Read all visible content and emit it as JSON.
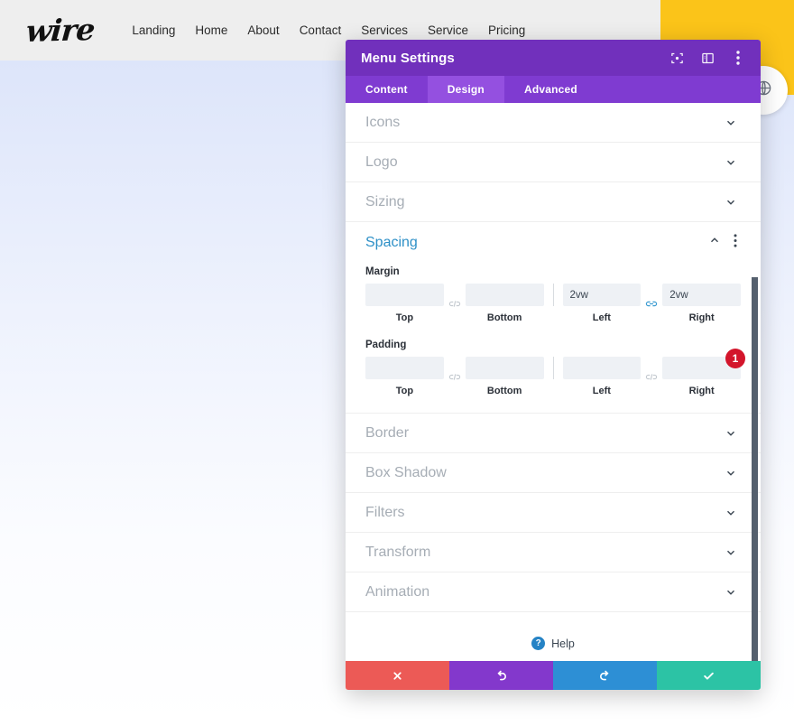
{
  "site": {
    "logo_text": "wire",
    "nav_links": [
      {
        "label": "Landing"
      },
      {
        "label": "Home"
      },
      {
        "label": "About"
      },
      {
        "label": "Contact"
      },
      {
        "label": "Services"
      },
      {
        "label": "Service"
      },
      {
        "label": "Pricing"
      }
    ],
    "round_button_icon": "globe-icon",
    "accent_yellow": "#fbc419"
  },
  "modal": {
    "title": "Menu Settings",
    "header_icons": [
      {
        "name": "focus-icon"
      },
      {
        "name": "layout-panel-icon"
      },
      {
        "name": "more-vertical-icon"
      }
    ],
    "tabs": [
      {
        "label": "Content",
        "active": false
      },
      {
        "label": "Design",
        "active": true
      },
      {
        "label": "Advanced",
        "active": false
      }
    ],
    "sections": [
      {
        "label": "Icons",
        "open": false
      },
      {
        "label": "Logo",
        "open": false
      },
      {
        "label": "Sizing",
        "open": false
      }
    ],
    "spacing": {
      "label": "Spacing",
      "open": true,
      "collapse_icon": "chevron-up-icon",
      "options_icon": "more-vertical-icon",
      "margin": {
        "label": "Margin",
        "top": {
          "label": "Top",
          "value": "",
          "placeholder": ""
        },
        "bottom": {
          "label": "Bottom",
          "value": "",
          "placeholder": ""
        },
        "left": {
          "label": "Left",
          "value": "2vw",
          "placeholder": ""
        },
        "right": {
          "label": "Right",
          "value": "2vw",
          "placeholder": ""
        },
        "link_vertical": "unlinked",
        "link_horizontal": "linked"
      },
      "padding": {
        "label": "Padding",
        "top": {
          "label": "Top",
          "value": "",
          "placeholder": ""
        },
        "bottom": {
          "label": "Bottom",
          "value": "",
          "placeholder": ""
        },
        "left": {
          "label": "Left",
          "value": "",
          "placeholder": ""
        },
        "right": {
          "label": "Right",
          "value": "",
          "placeholder": ""
        },
        "link_vertical": "unlinked",
        "link_horizontal": "unlinked"
      },
      "badge": "1"
    },
    "sections_after": [
      {
        "label": "Border",
        "open": false
      },
      {
        "label": "Box Shadow",
        "open": false
      },
      {
        "label": "Filters",
        "open": false
      },
      {
        "label": "Transform",
        "open": false
      },
      {
        "label": "Animation",
        "open": false
      }
    ],
    "help": {
      "label": "Help",
      "icon": "question-circle-icon"
    },
    "footer_buttons": [
      {
        "name": "cancel-button",
        "icon": "close-icon",
        "color": "#ec5a56"
      },
      {
        "name": "undo-button",
        "icon": "undo-icon",
        "color": "#8338cc"
      },
      {
        "name": "redo-button",
        "icon": "redo-icon",
        "color": "#2d8fd5"
      },
      {
        "name": "save-button",
        "icon": "check-icon",
        "color": "#2cc3a5"
      }
    ],
    "colors": {
      "header_purple": "#7130bc",
      "tabbar_purple": "#7f3bd1",
      "tab_active_purple": "#9450e0",
      "section_title_blue": "#2e90c7",
      "badge_red": "#d3152b"
    }
  }
}
